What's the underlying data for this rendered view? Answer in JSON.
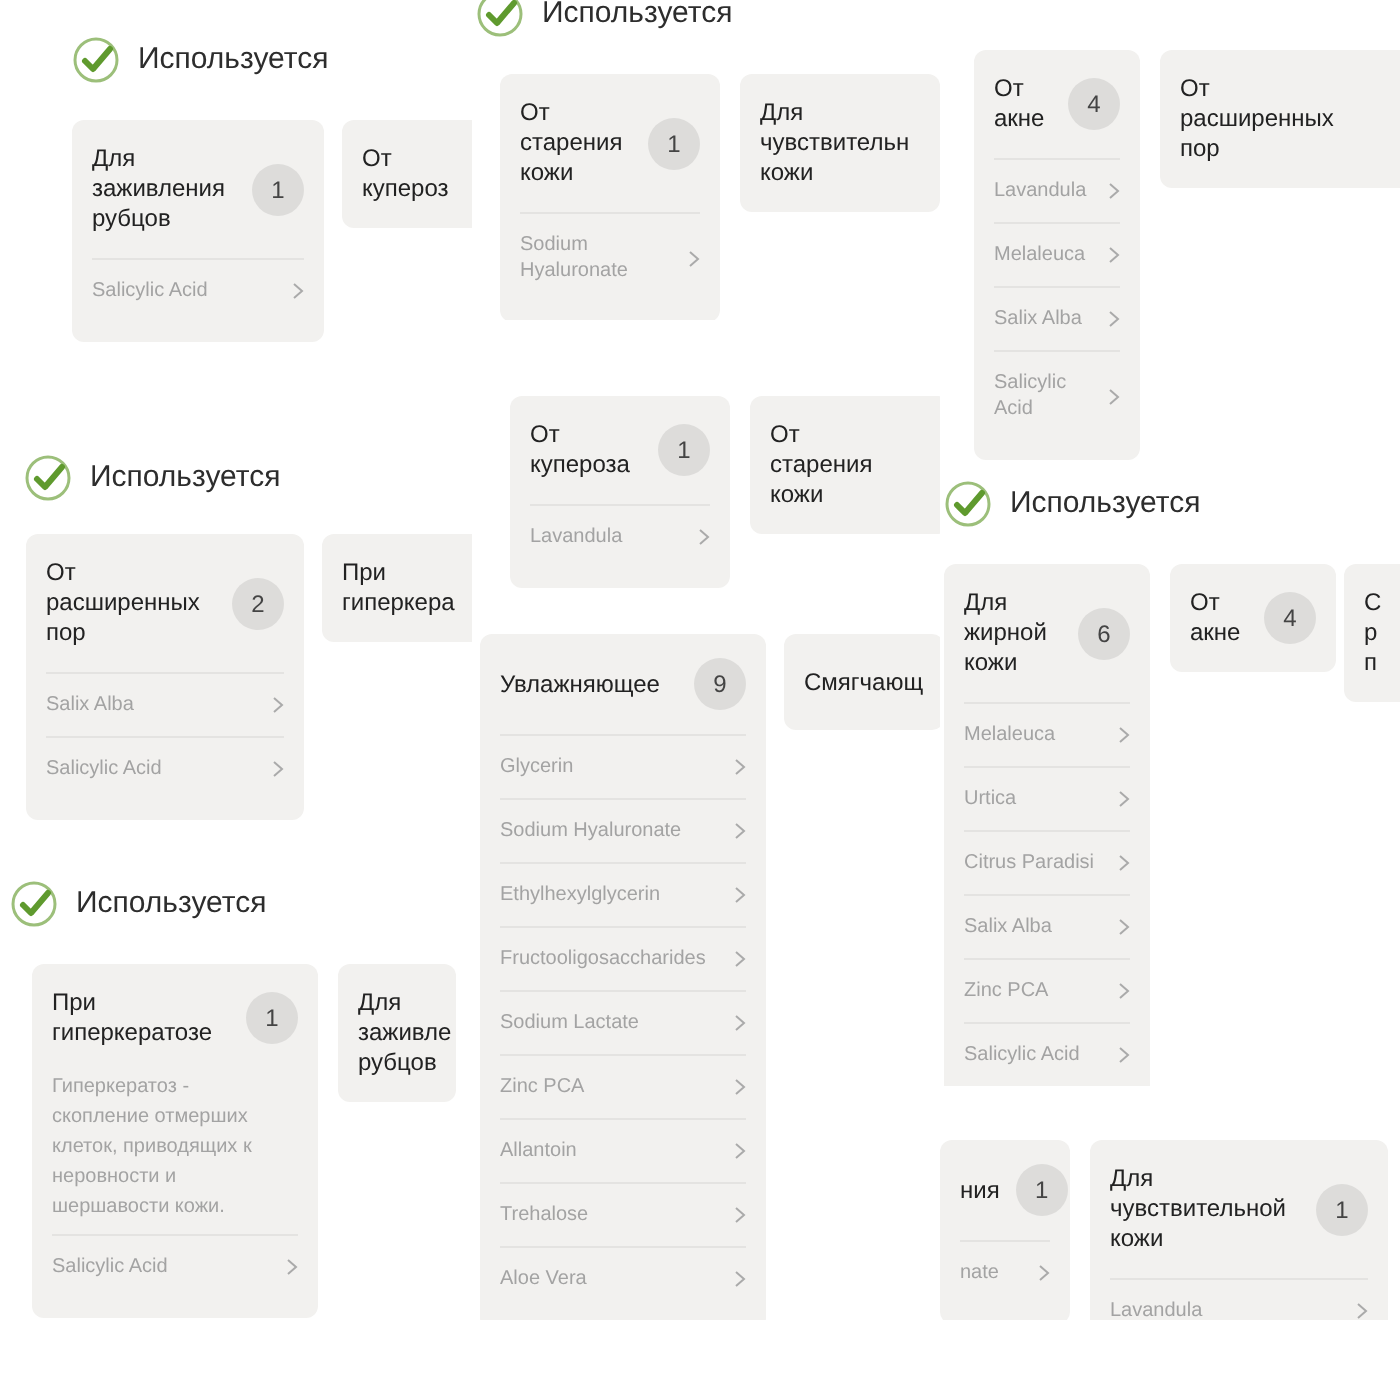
{
  "panels": [
    {
      "header": "Используется",
      "cards": [
        {
          "title": "Для заживления рубцов",
          "count": "1",
          "items": [
            "Salicylic Acid"
          ]
        },
        {
          "title": "От купероз"
        }
      ]
    },
    {
      "header": "Используется",
      "cards": [
        {
          "title": "От старения кожи",
          "count": "1",
          "items": [
            "Sodium Hyaluronate"
          ]
        },
        {
          "title": "Для чувствительн кожи"
        }
      ]
    },
    {
      "cards": [
        {
          "title": "От купероза",
          "count": "1",
          "items": [
            "Lavandula"
          ]
        },
        {
          "title": "От старения кожи"
        }
      ]
    },
    {
      "cards": [
        {
          "title": "От акне",
          "count": "4",
          "items": [
            "Lavandula",
            "Melaleuca",
            "Salix Alba",
            "Salicylic Acid"
          ]
        },
        {
          "title": "От расширенных пор"
        }
      ]
    },
    {
      "header": "Используется",
      "cards": [
        {
          "title": "От расширенных пор",
          "count": "2",
          "items": [
            "Salix Alba",
            "Salicylic Acid"
          ]
        },
        {
          "title": "При гиперкера"
        }
      ]
    },
    {
      "header": "Используется",
      "cards": [
        {
          "title": "При гиперкератозе",
          "count": "1",
          "description": "Гиперкератоз - скопление отмерших клеток, приводящих к неровности и шершавости кожи.",
          "items": [
            "Salicylic Acid"
          ]
        },
        {
          "title": "Для заживле рубцов"
        }
      ]
    },
    {
      "cards": [
        {
          "title": "Увлажняющее",
          "count": "9",
          "items": [
            "Glycerin",
            "Sodium Hyaluronate",
            "Ethylhexylglycerin",
            "Fructooligosaccharides",
            "Sodium Lactate",
            "Zinc PCA",
            "Allantoin",
            "Trehalose",
            "Aloe Vera"
          ]
        },
        {
          "title": "Смягчающ"
        }
      ]
    },
    {
      "header": "Используется",
      "cards": [
        {
          "title": "Для жирной кожи",
          "count": "6",
          "items": [
            "Melaleuca",
            "Urtica",
            "Citrus Paradisi",
            "Salix Alba",
            "Zinc PCA",
            "Salicylic Acid"
          ]
        },
        {
          "title": "От акне",
          "count": "4"
        },
        {
          "title": "С р п"
        }
      ]
    },
    {
      "cards": [
        {
          "title": "ния",
          "count": "1",
          "items": [
            "nate"
          ]
        },
        {
          "title": "Для чувствительной кожи",
          "count": "1",
          "items": [
            "Lavandula"
          ]
        }
      ]
    }
  ]
}
